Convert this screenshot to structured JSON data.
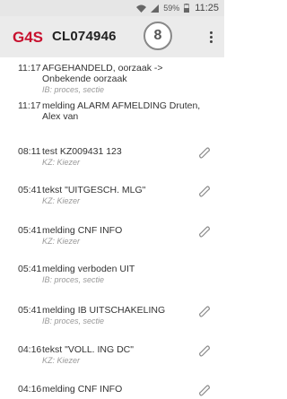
{
  "status_bar": {
    "battery": "59%",
    "time": "11:25"
  },
  "header": {
    "logo_text": "G4S",
    "title": "CL074946",
    "count": "8"
  },
  "entries": [
    {
      "time": "11:17",
      "text": "AFGEHANDELD, oorzaak -> Onbekende oorzaak",
      "sub": "IB: proces, sectie",
      "attachment": false
    },
    {
      "time": "11:17",
      "text": "melding ALARM AFMELDING  Druten, Alex van",
      "sub": "",
      "attachment": false
    },
    {
      "time": "08:11",
      "text": "test KZ009431 123",
      "sub": "KZ: Kiezer",
      "attachment": true
    },
    {
      "time": "05:41",
      "text": "tekst \"UITGESCH. MLG\"",
      "sub": "KZ: Kiezer",
      "attachment": true
    },
    {
      "time": "05:41",
      "text": "melding CNF INFO",
      "sub": "KZ: Kiezer",
      "attachment": true
    },
    {
      "time": "05:41",
      "text": "melding verboden UIT",
      "sub": "IB: proces, sectie",
      "attachment": false
    },
    {
      "time": "05:41",
      "text": "melding IB UITSCHAKELING",
      "sub": "IB: proces, sectie",
      "attachment": true
    },
    {
      "time": "04:16",
      "text": "tekst \"VOLL. ING DC\"",
      "sub": "KZ: Kiezer",
      "attachment": true
    },
    {
      "time": "04:16",
      "text": "melding CNF INFO",
      "sub": "",
      "attachment": true
    }
  ]
}
